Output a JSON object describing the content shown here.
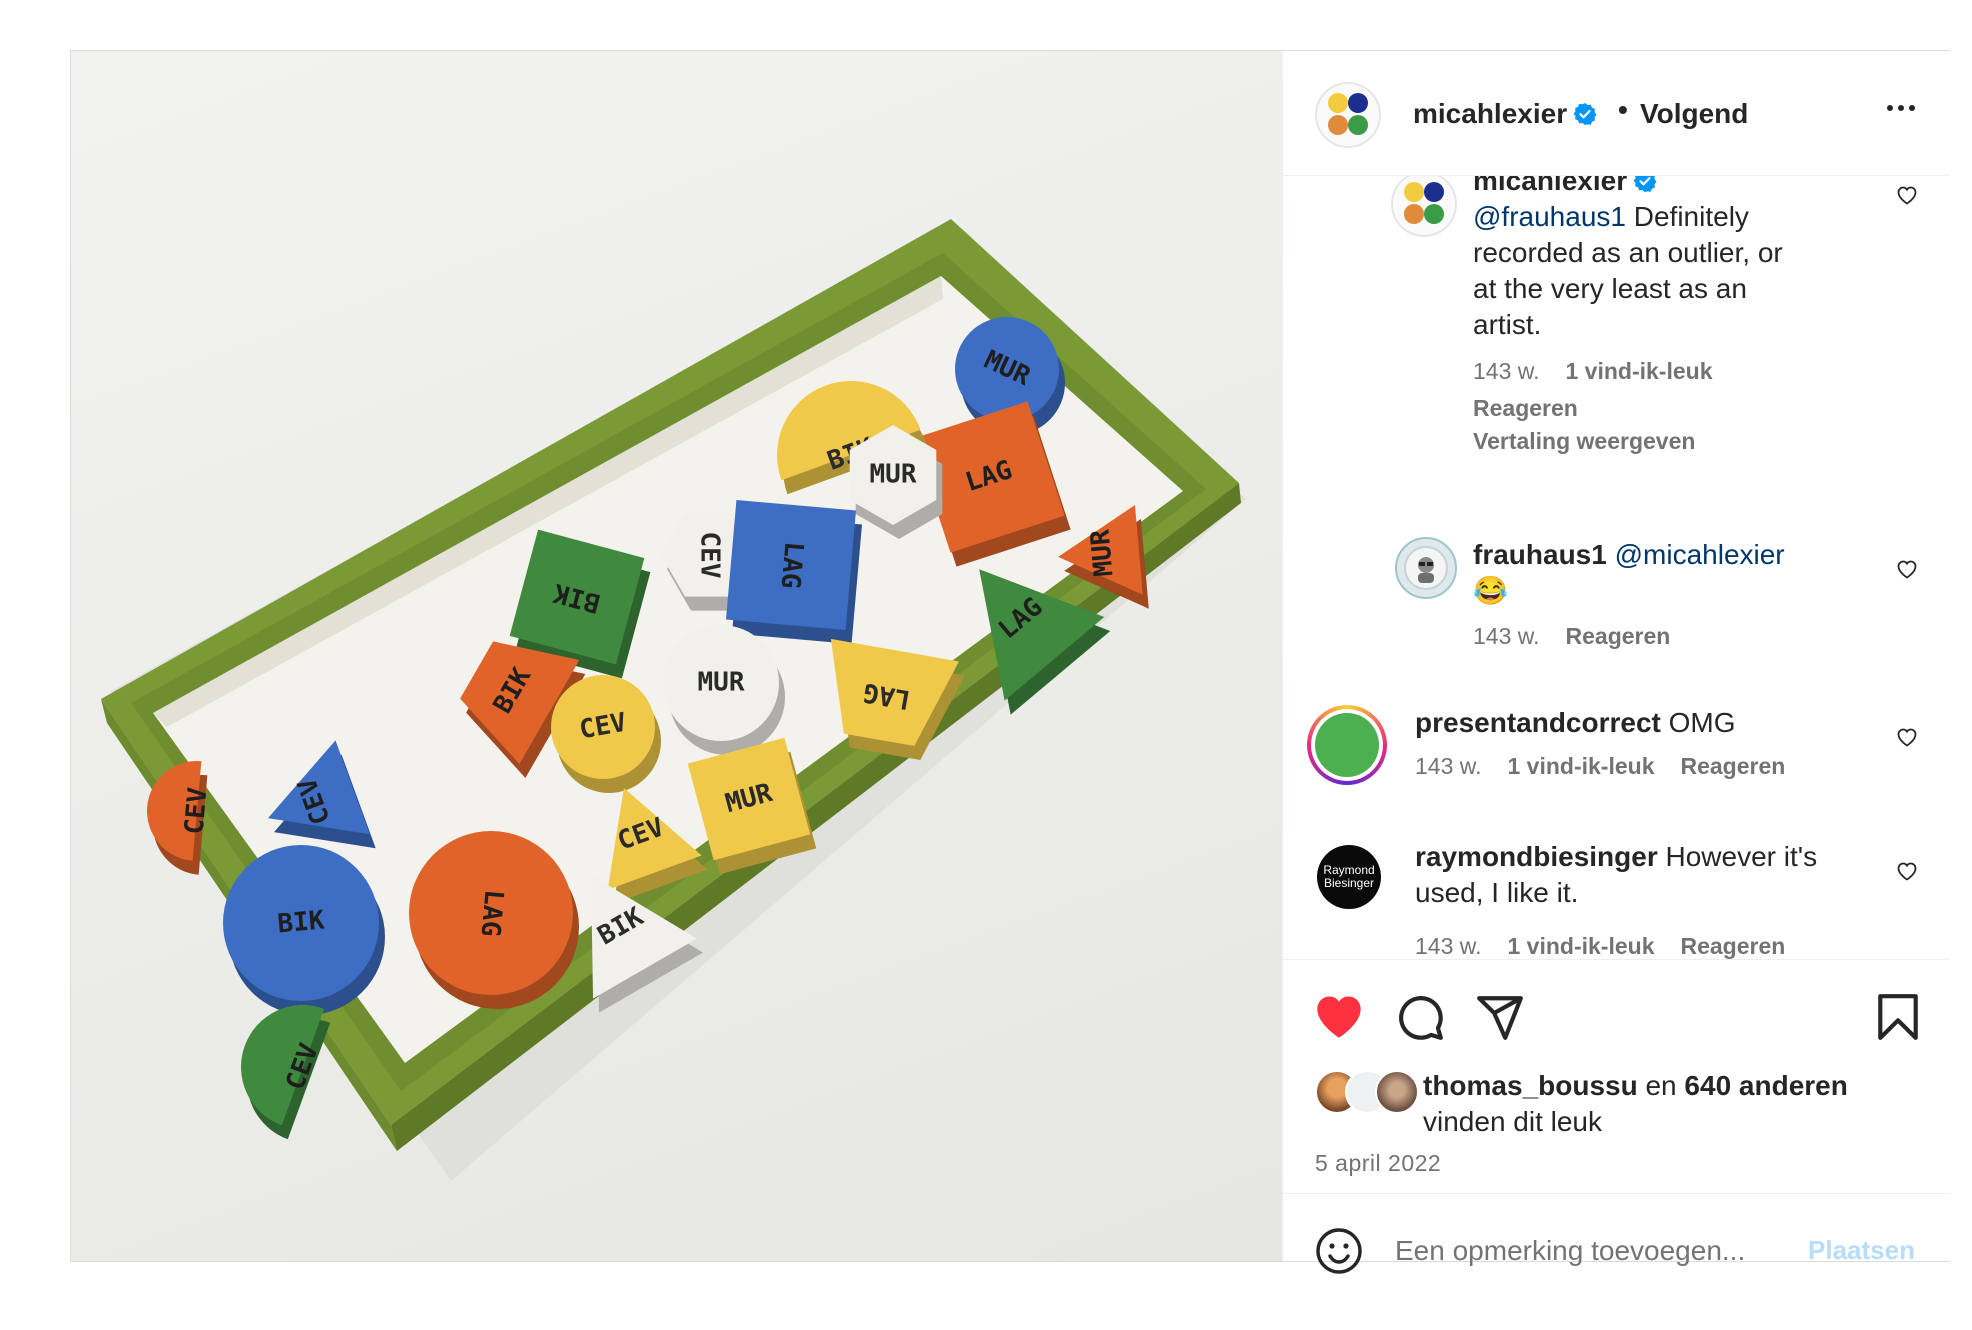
{
  "post": {
    "author": {
      "username": "micahlexier",
      "verified": true,
      "follow_status": "Volgend",
      "separator": "•",
      "avatar_colors": [
        "#f2cc3d",
        "#1b2f8e",
        "#e08a3c",
        "#3b9b47"
      ]
    },
    "photo": {
      "pieces": [
        {
          "shape": "circle",
          "label": "MUR",
          "color": "#3d6ec4"
        },
        {
          "shape": "square",
          "label": "LAG",
          "color": "#e0642a"
        },
        {
          "shape": "semicircle",
          "label": "BIK",
          "color": "#f0c94a"
        },
        {
          "shape": "hexagon",
          "label": "MUR",
          "color": "#f2f0ea"
        },
        {
          "shape": "hexagon",
          "label": "CEV",
          "color": "#f2f0ea"
        },
        {
          "shape": "square",
          "label": "LAG",
          "color": "#3d6ec4"
        },
        {
          "shape": "triangle",
          "label": "MUR",
          "color": "#e0642a"
        },
        {
          "shape": "triangle",
          "label": "LAG",
          "color": "#3f8a3e"
        },
        {
          "shape": "square",
          "label": "BIK",
          "color": "#3f8a3e"
        },
        {
          "shape": "trapezoid",
          "label": "BIK",
          "color": "#e0642a"
        },
        {
          "shape": "circle",
          "label": "MUR",
          "color": "#f2f0ea"
        },
        {
          "shape": "trapezoid",
          "label": "LAG",
          "color": "#f0c94a"
        },
        {
          "shape": "circle",
          "label": "CEV",
          "color": "#f0c94a"
        },
        {
          "shape": "triangle",
          "label": "CEV",
          "color": "#3d6ec4"
        },
        {
          "shape": "semicircle",
          "label": "CEV",
          "color": "#e0642a"
        },
        {
          "shape": "triangle",
          "label": "CEV",
          "color": "#f0c94a"
        },
        {
          "shape": "square",
          "label": "MUR",
          "color": "#f0c94a"
        },
        {
          "shape": "circle",
          "label": "BIK",
          "color": "#3d6ec4"
        },
        {
          "shape": "circle",
          "label": "LAG",
          "color": "#e0642a"
        },
        {
          "shape": "triangle",
          "label": "BIK",
          "color": "#f2f0ea"
        },
        {
          "shape": "semicircle",
          "label": "CEV",
          "color": "#3f8a3e"
        }
      ]
    },
    "comments": [
      {
        "username": "micahlexier",
        "verified": true,
        "mention": "@frauhaus1",
        "body_lines": [
          "Definitely",
          "recorded as an outlier, or",
          "at the very least as an",
          "artist."
        ],
        "time": "143 w.",
        "likes": "1 vind-ik-leuk",
        "reply": "Reageren",
        "translate": "Vertaling weergeven"
      },
      {
        "username": "frauhaus1",
        "mention": "@micahlexier",
        "emoji": "😂",
        "time": "143 w.",
        "reply": "Reageren"
      },
      {
        "username": "presentandcorrect",
        "body": "OMG",
        "time": "143 w.",
        "likes": "1 vind-ik-leuk",
        "reply": "Reageren",
        "avatar_color": "#4caf50"
      },
      {
        "username": "raymondbiesinger",
        "body_lines": [
          "However it's",
          "used, I like it."
        ],
        "avatar_text": [
          "Raymond",
          "Biesinger"
        ],
        "time": "143 w.",
        "likes": "1 vind-ik-leuk",
        "reply": "Reageren"
      }
    ],
    "actions": {
      "liked": true,
      "like_color": "#ff3040",
      "likers_name": "thomas_boussu",
      "likers_joiner": "en",
      "likers_others": "640 anderen",
      "likers_suffix": "vinden dit leuk",
      "date": "5 april 2022"
    },
    "add_comment": {
      "placeholder": "Een opmerking toevoegen...",
      "post_label": "Plaatsen"
    }
  }
}
